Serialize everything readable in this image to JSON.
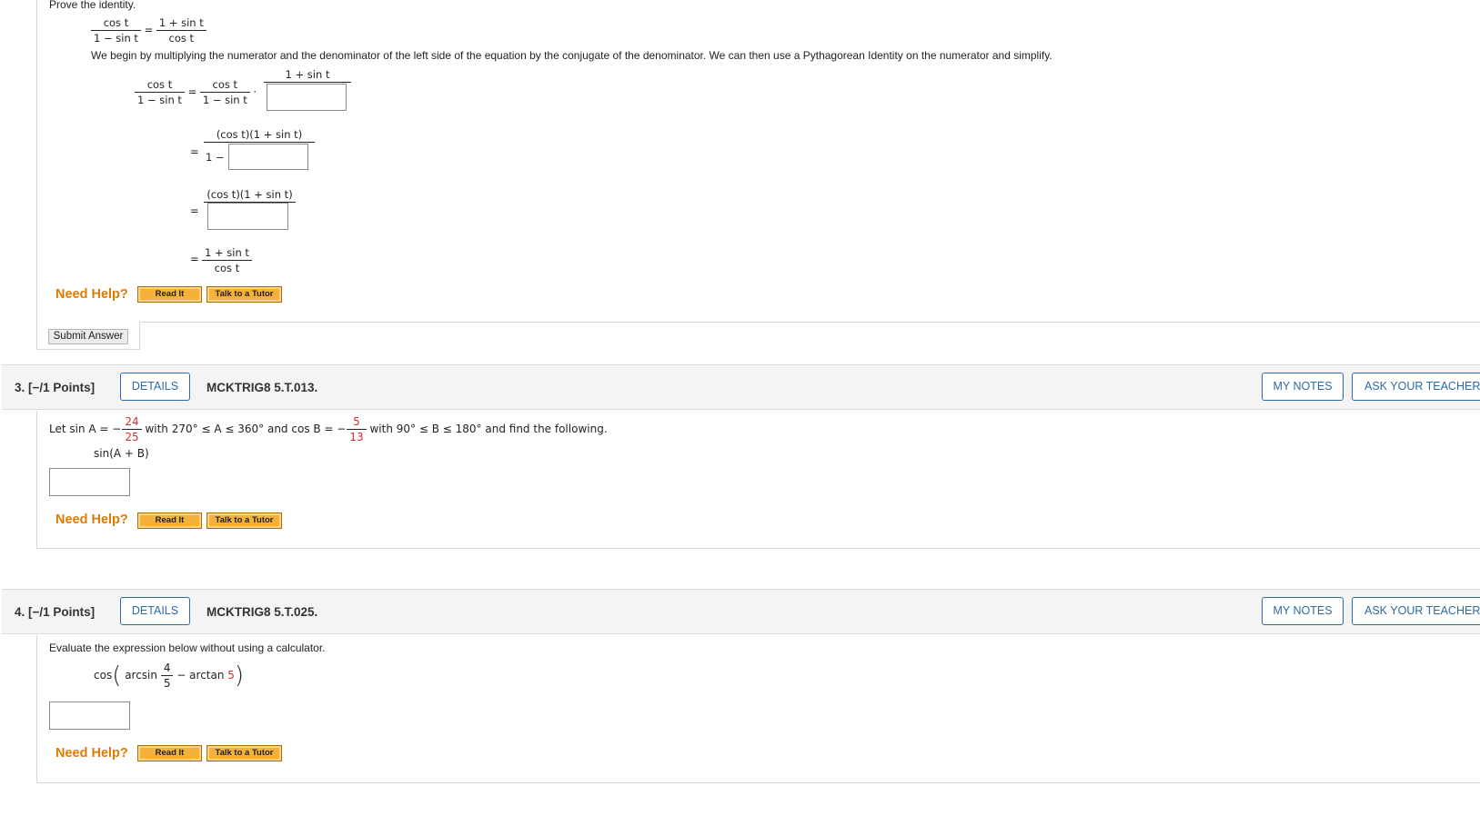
{
  "q2": {
    "instruction": "Prove the identity.",
    "identity": {
      "lhs_num": "cos t",
      "lhs_den": "1 − sin t",
      "eq": "=",
      "rhs_num": "1 + sin t",
      "rhs_den": "cos t"
    },
    "explanation": "We begin by multiplying the numerator and the denominator of the left side of the equation by the conjugate of the denominator. We can then use a Pythagorean Identity on the numerator and simplify.",
    "step1": {
      "lhs_num": "cos t",
      "lhs_den": "1 − sin t",
      "eq": "=",
      "mid_num": "cos t",
      "mid_den": "1 − sin t",
      "dot": "·",
      "mult_num": "1 + sin t"
    },
    "step2": {
      "eq": "=",
      "num": "(cos t)(1 + sin t)",
      "den_prefix": "1 −"
    },
    "step3": {
      "eq": "=",
      "num": "(cos t)(1 + sin t)"
    },
    "step4": {
      "eq": "=",
      "num": "1 + sin t",
      "den": "cos t"
    },
    "need_help": "Need Help?",
    "read_it": "Read It",
    "talk_tutor": "Talk to a Tutor",
    "submit": "Submit Answer"
  },
  "q3": {
    "number": "3.",
    "points": "[−/1 Points]",
    "details": "DETAILS",
    "code": "MCKTRIG8 5.T.013.",
    "my_notes": "MY NOTES",
    "ask": "ASK YOUR TEACHER",
    "let": "Let",
    "sinA": "sin A = −",
    "sinA_num": "24",
    "sinA_den": "25",
    "with1": "with",
    "rangeA": "270° ≤ A ≤ 360°",
    "and1": "and",
    "cosB": "cos B = −",
    "cosB_num": "5",
    "cosB_den": "13",
    "with2": "with",
    "rangeB": "90° ≤ B ≤ 180°",
    "tail": "and find the following.",
    "target": "sin(A + B)",
    "need_help": "Need Help?",
    "read_it": "Read It",
    "talk_tutor": "Talk to a Tutor"
  },
  "q4": {
    "number": "4.",
    "points": "[−/1 Points]",
    "details": "DETAILS",
    "code": "MCKTRIG8 5.T.025.",
    "my_notes": "MY NOTES",
    "ask": "ASK YOUR TEACHER",
    "instruction": "Evaluate the expression below without using a calculator.",
    "cos": "cos",
    "arcsin": "arcsin",
    "frac_num": "4",
    "frac_den": "5",
    "minus_arctan": "− arctan",
    "arctan_val": "5",
    "need_help": "Need Help?",
    "read_it": "Read It",
    "talk_tutor": "Talk to a Tutor"
  },
  "colors": {
    "help": "#e07a00",
    "button": "#f6b13d",
    "pill": "#2d6aa3",
    "red_value": "#d62e2e"
  }
}
